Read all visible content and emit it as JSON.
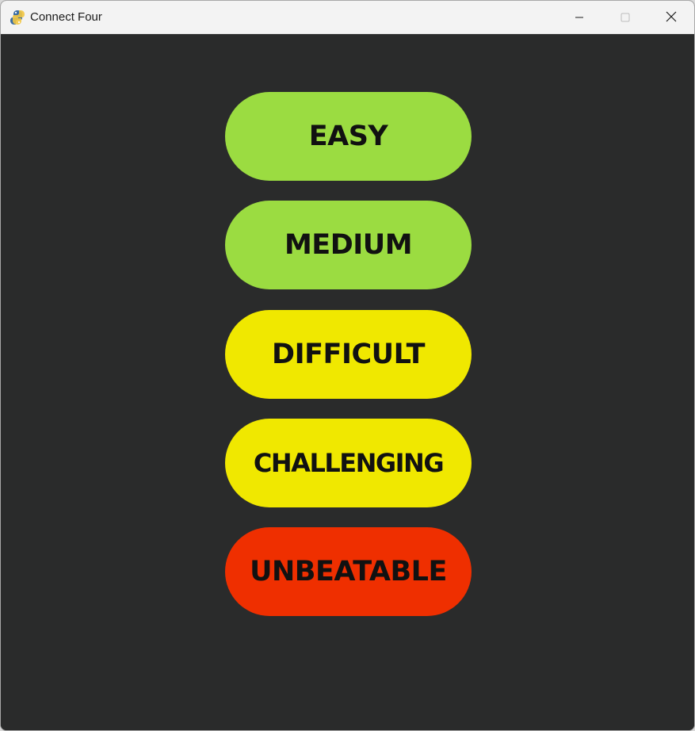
{
  "window": {
    "title": "Connect Four",
    "app_icon": "pygame-snake-icon",
    "controls": {
      "minimize_icon": "minimize-icon",
      "maximize_icon": "maximize-icon",
      "close_icon": "close-icon"
    }
  },
  "menu": {
    "background_color": "#2a2b2b",
    "buttons": [
      {
        "label": "EASY",
        "color": "#9bdc41"
      },
      {
        "label": "MEDIUM",
        "color": "#9bdc41"
      },
      {
        "label": "DIFFICULT",
        "color": "#f0e800"
      },
      {
        "label": "CHALLENGING",
        "color": "#f0e800"
      },
      {
        "label": "UNBEATABLE",
        "color": "#ef2f00"
      }
    ]
  }
}
